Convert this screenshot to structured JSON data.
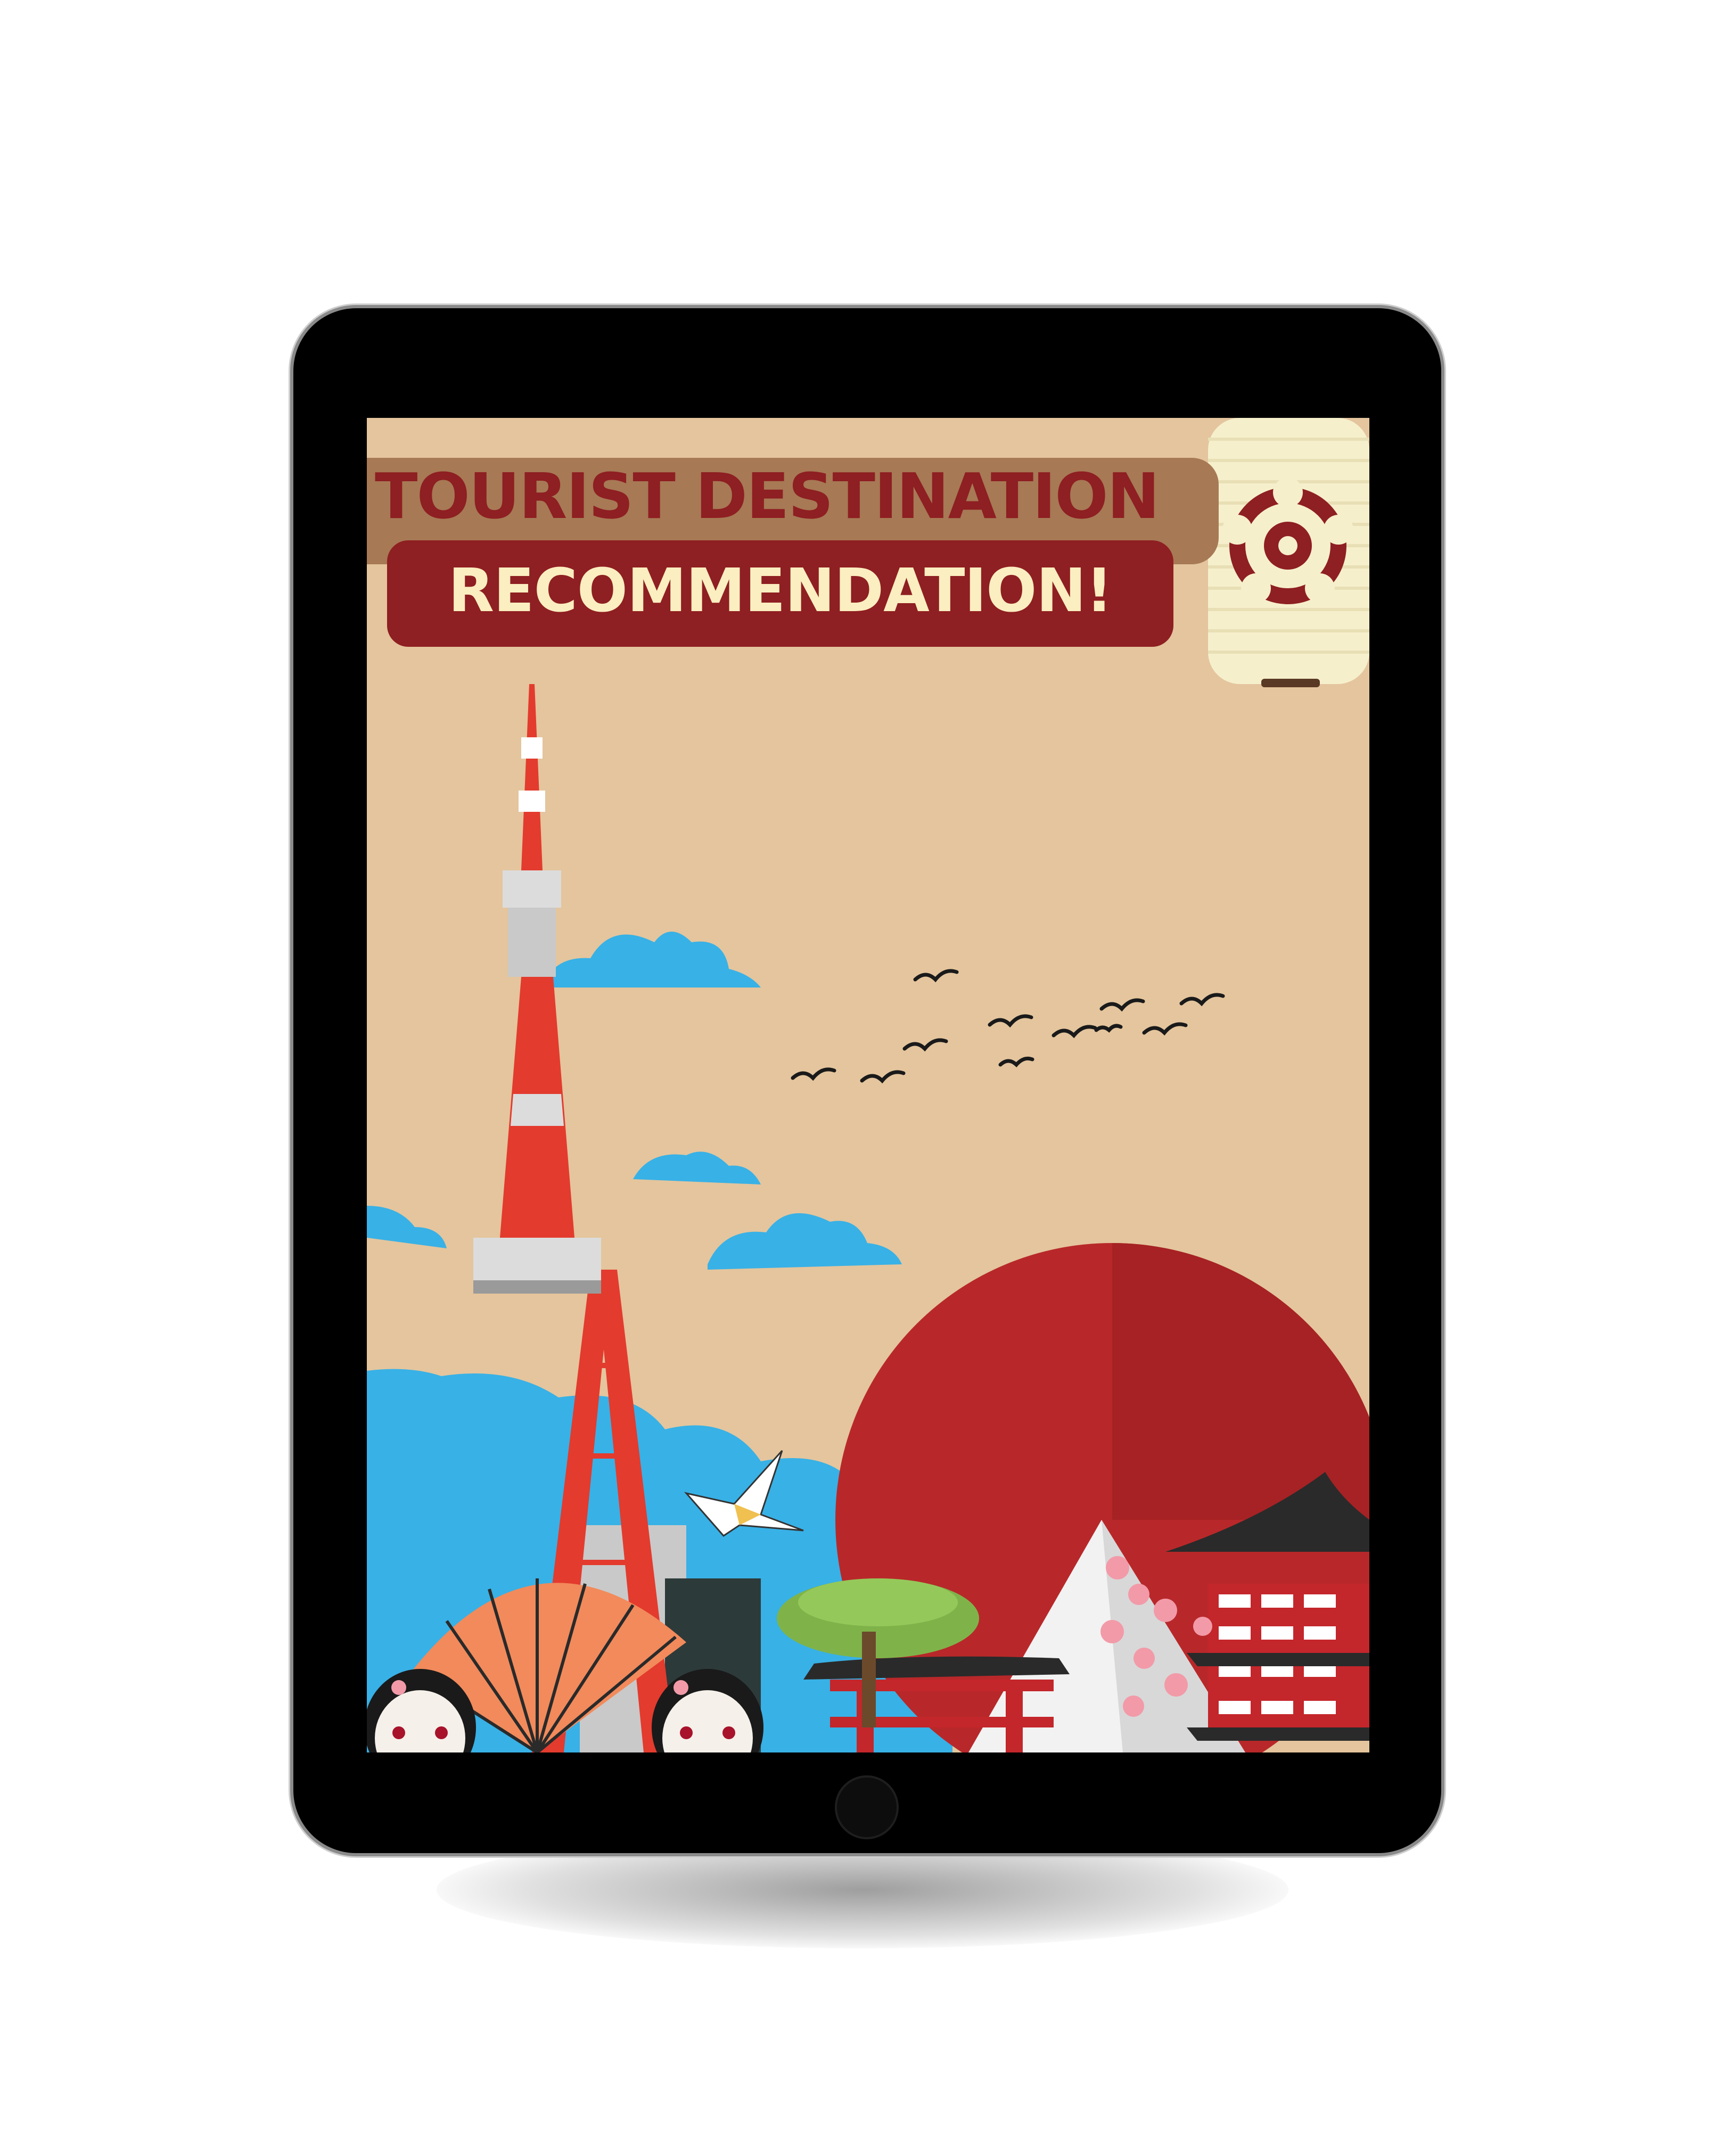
{
  "poster": {
    "title_line1": "TOURIST DESTINATION",
    "title_line2": "RECOMMENDATION!"
  },
  "colors": {
    "background": "#e4c59d",
    "banner_brown": "#a77955",
    "banner_red": "#8e1f22",
    "title_cream": "#fbeec0",
    "sun_red": "#b8282a",
    "sky_blue": "#38b1e6"
  },
  "icons": [
    "lantern-icon",
    "tokyo-tower-icon",
    "sun-icon",
    "birds-icon",
    "paper-crane-icon",
    "torii-gate-icon",
    "pagoda-icon",
    "mount-fuji-icon",
    "geisha-icon",
    "fan-icon",
    "bonsai-icon",
    "home-button-icon"
  ]
}
